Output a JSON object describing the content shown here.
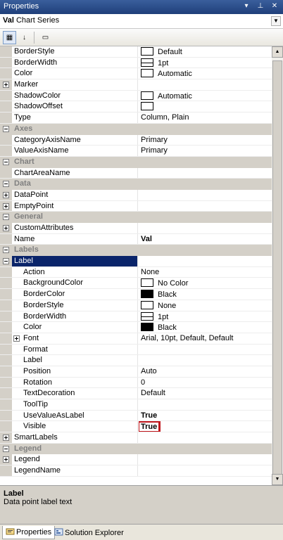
{
  "window": {
    "title": "Properties",
    "buttons": [
      "▾",
      "⊥",
      "✕"
    ]
  },
  "object_selector": {
    "name": "Val",
    "type": "Chart Series"
  },
  "toolbar": {
    "tools": [
      "categorized-icon",
      "alphabetical-icon",
      "property-pages-icon"
    ]
  },
  "grid": {
    "rows": [
      {
        "kind": "prop",
        "name": "BorderStyle",
        "value": "Default",
        "swatch": "white"
      },
      {
        "kind": "prop",
        "name": "BorderWidth",
        "value": "1pt",
        "swatch": "line"
      },
      {
        "kind": "prop",
        "name": "Color",
        "value": "Automatic",
        "swatch": "white"
      },
      {
        "kind": "prop",
        "name": "Marker",
        "value": "",
        "expander": "plus"
      },
      {
        "kind": "prop",
        "name": "ShadowColor",
        "value": "Automatic",
        "swatch": "white"
      },
      {
        "kind": "prop",
        "name": "ShadowOffset",
        "value": "",
        "swatch": "white"
      },
      {
        "kind": "prop",
        "name": "Type",
        "value": "Column, Plain"
      },
      {
        "kind": "cat",
        "name": "Axes"
      },
      {
        "kind": "prop",
        "name": "CategoryAxisName",
        "value": "Primary"
      },
      {
        "kind": "prop",
        "name": "ValueAxisName",
        "value": "Primary"
      },
      {
        "kind": "cat",
        "name": "Chart"
      },
      {
        "kind": "prop",
        "name": "ChartAreaName",
        "value": ""
      },
      {
        "kind": "cat",
        "name": "Data"
      },
      {
        "kind": "prop",
        "name": "DataPoint",
        "value": "",
        "expander": "plus"
      },
      {
        "kind": "prop",
        "name": "EmptyPoint",
        "value": "",
        "expander": "plus"
      },
      {
        "kind": "cat",
        "name": "General"
      },
      {
        "kind": "prop",
        "name": "CustomAttributes",
        "value": "",
        "expander": "plus"
      },
      {
        "kind": "prop",
        "name": "Name",
        "value": "Val",
        "bold": true
      },
      {
        "kind": "cat",
        "name": "Labels"
      },
      {
        "kind": "prop",
        "name": "Label",
        "value": "",
        "expander": "minus",
        "selected": true
      },
      {
        "kind": "child",
        "name": "Action",
        "value": "None"
      },
      {
        "kind": "child",
        "name": "BackgroundColor",
        "value": "No Color",
        "swatch": "white"
      },
      {
        "kind": "child",
        "name": "BorderColor",
        "value": "Black",
        "swatch": "black"
      },
      {
        "kind": "child",
        "name": "BorderStyle",
        "value": "None",
        "swatch": "white"
      },
      {
        "kind": "child",
        "name": "BorderWidth",
        "value": "1pt",
        "swatch": "line"
      },
      {
        "kind": "child",
        "name": "Color",
        "value": "Black",
        "swatch": "black"
      },
      {
        "kind": "child",
        "name": "Font",
        "value": "Arial, 10pt, Default, Default",
        "expander": "plus"
      },
      {
        "kind": "child",
        "name": "Format",
        "value": ""
      },
      {
        "kind": "child",
        "name": "Label",
        "value": ""
      },
      {
        "kind": "child",
        "name": "Position",
        "value": "Auto"
      },
      {
        "kind": "child",
        "name": "Rotation",
        "value": "0"
      },
      {
        "kind": "child",
        "name": "TextDecoration",
        "value": "Default"
      },
      {
        "kind": "child",
        "name": "ToolTip",
        "value": ""
      },
      {
        "kind": "child",
        "name": "UseValueAsLabel",
        "value": "True",
        "bold": true
      },
      {
        "kind": "child",
        "name": "Visible",
        "value": "True",
        "bold": true,
        "highlighted": true
      },
      {
        "kind": "prop",
        "name": "SmartLabels",
        "value": "",
        "expander": "plus"
      },
      {
        "kind": "cat",
        "name": "Legend"
      },
      {
        "kind": "prop",
        "name": "Legend",
        "value": "",
        "expander": "plus"
      },
      {
        "kind": "prop",
        "name": "LegendName",
        "value": ""
      }
    ]
  },
  "description": {
    "title": "Label",
    "text": "Data point label text"
  },
  "tabs": [
    {
      "label": "Properties",
      "active": true
    },
    {
      "label": "Solution Explorer",
      "active": false
    }
  ],
  "colors": {
    "title_bar": "#1f3f7a",
    "selection": "#0a246a",
    "highlight_box": "#c0161c",
    "category_bg": "#d4d0c8"
  }
}
